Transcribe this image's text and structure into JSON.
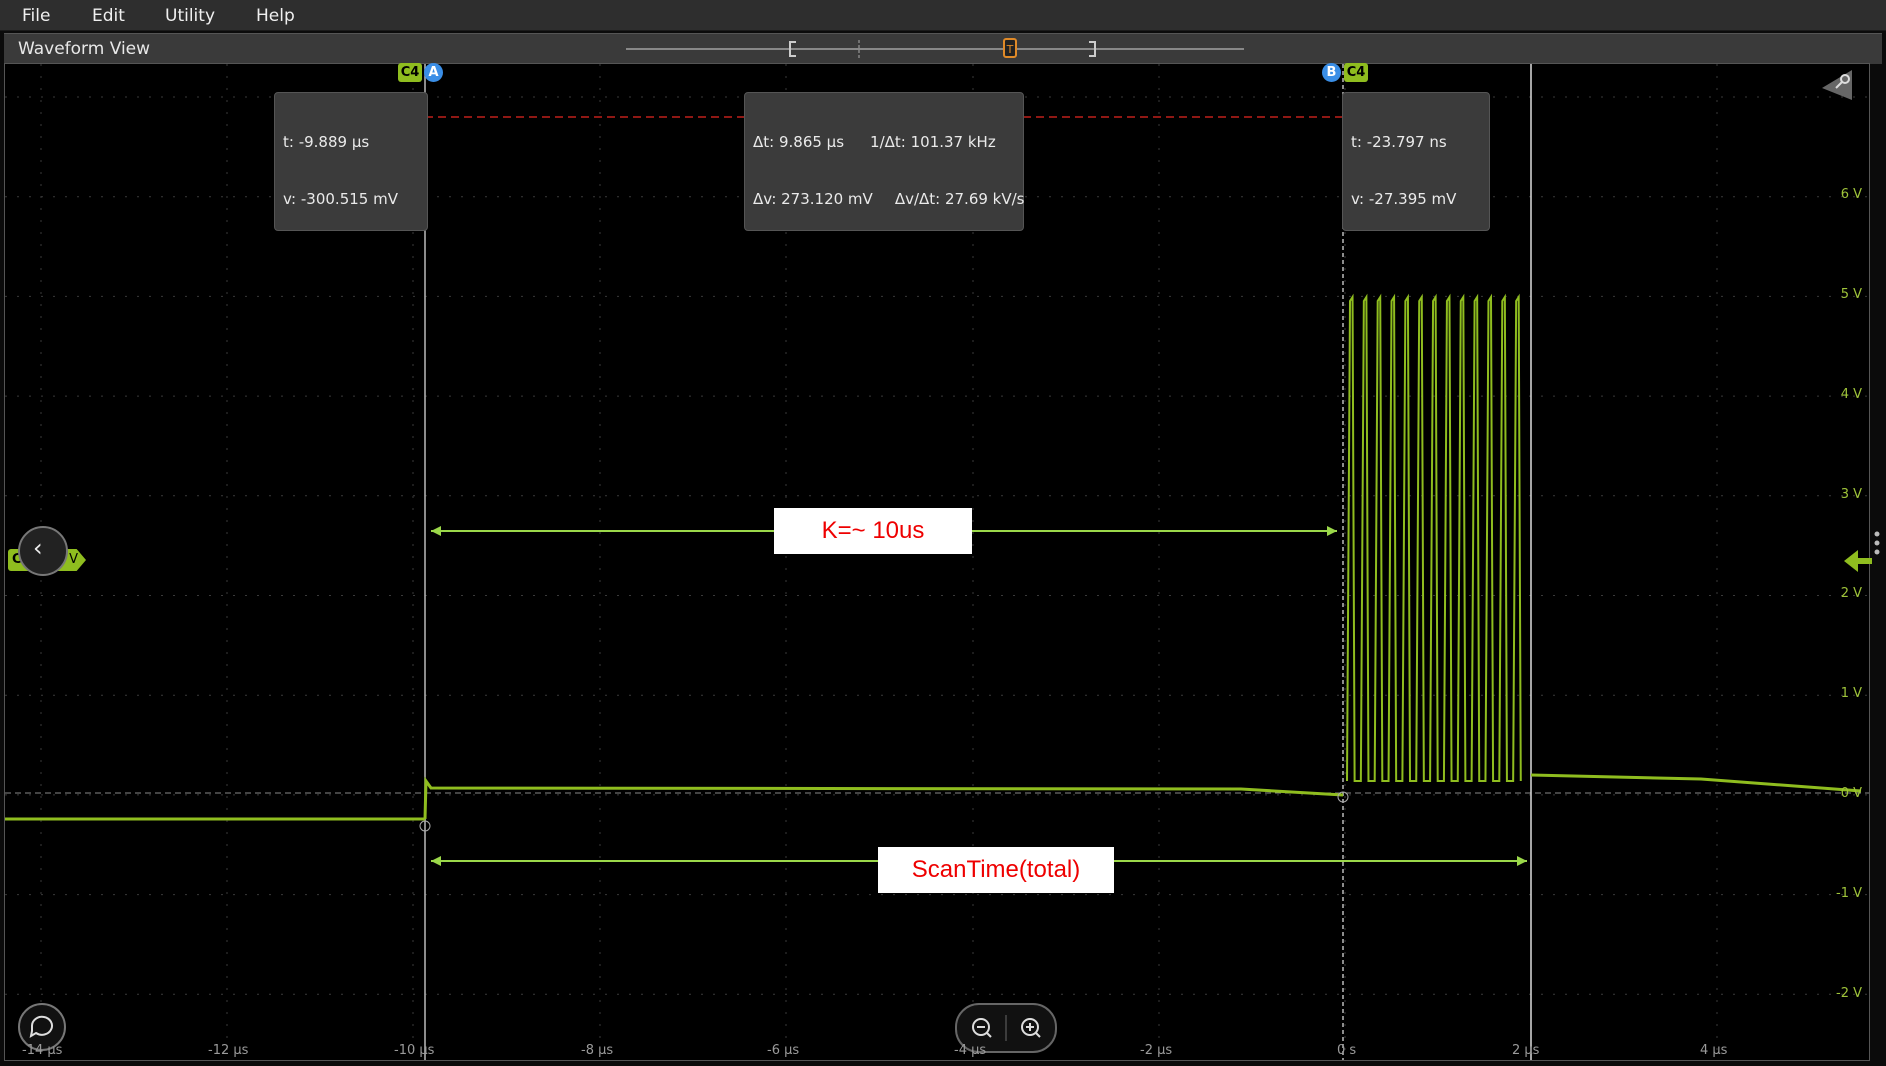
{
  "menu": {
    "file": "File",
    "edit": "Edit",
    "utility": "Utility",
    "help": "Help"
  },
  "window": {
    "title": "Waveform View"
  },
  "cursor_a": {
    "channel_tag": "C4",
    "cursor_tag": "A",
    "time": "t: -9.889 µs",
    "voltage": "v: -300.515 mV"
  },
  "cursor_b": {
    "channel_tag": "C4",
    "cursor_tag": "B",
    "time": "t: -23.797 ns",
    "voltage": "v: -27.395 mV"
  },
  "delta": {
    "dt": "Δt: 9.865 µs",
    "inv_dt": "1/Δt: 101.37 kHz",
    "dv": "Δv: 273.120 mV",
    "dvdt": "Δv/Δt: 27.69 kV/s"
  },
  "annotations": {
    "k_label": "K=~ 10us",
    "scan_label": "ScanTime(total)"
  },
  "channel_badge": {
    "label": "C4",
    "offset": "0 V"
  },
  "y_axis": [
    "6 V",
    "5 V",
    "4 V",
    "3 V",
    "2 V",
    "1 V",
    "0 V",
    "-1 V",
    "-2 V"
  ],
  "x_axis": [
    "-14 µs",
    "-12 µs",
    "-10 µs",
    "-8 µs",
    "-6 µs",
    "-4 µs",
    "-2 µs",
    "0 s",
    "2 µs",
    "4 µs"
  ],
  "colors": {
    "trace": "#8fbd1f",
    "cursor_a": "#3a8ee6",
    "annotation_text": "#e00000",
    "delta_line": "#c0201a"
  }
}
